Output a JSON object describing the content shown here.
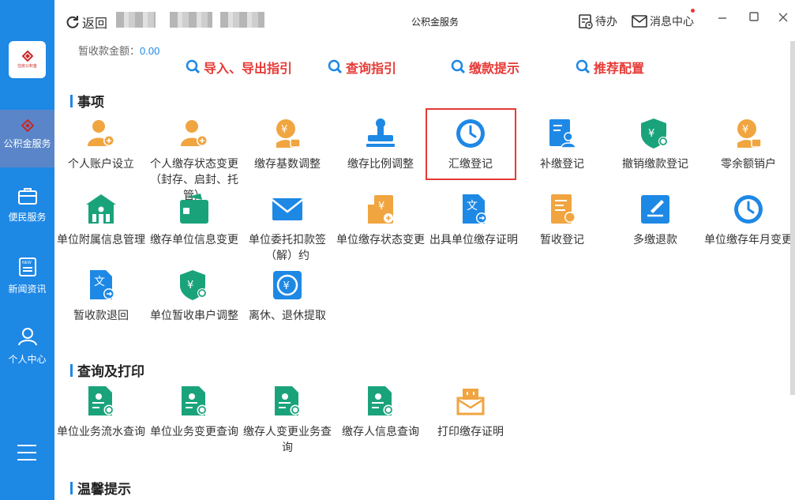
{
  "titlebar": {
    "back_label": "返回",
    "app_title": "公积金服务",
    "todo_label": "待办",
    "messages_label": "消息中心"
  },
  "sidebar": {
    "logo_text": "住房公积金",
    "items": [
      {
        "label": "公积金服务",
        "icon": "coin-icon"
      },
      {
        "label": "便民服务",
        "icon": "briefcase-icon"
      },
      {
        "label": "新闻资讯",
        "icon": "news-icon"
      },
      {
        "label": "个人中心",
        "icon": "user-icon"
      }
    ]
  },
  "main": {
    "amount_label": "暂收款金额：",
    "amount_value": "0.00",
    "guides": [
      "导入、导出指引",
      "查询指引",
      "缴款提示",
      "推荐配置"
    ],
    "sections": {
      "matters": "事项",
      "query": "查询及打印",
      "tips": "温馨提示"
    },
    "matters": [
      {
        "label": "个人账户设立",
        "icon": "user-add-icon"
      },
      {
        "label": "个人缴存状态变更（封存、启封、托管）",
        "icon": "user-add-icon"
      },
      {
        "label": "缴存基数调整",
        "icon": "money-lock-icon"
      },
      {
        "label": "缴存比例调整",
        "icon": "stamp-icon"
      },
      {
        "label": "汇缴登记",
        "icon": "clock-icon"
      },
      {
        "label": "补缴登记",
        "icon": "doc-user-icon"
      },
      {
        "label": "撤销缴款登记",
        "icon": "shield-search-icon"
      },
      {
        "label": "零余额销户",
        "icon": "money-lock-icon"
      },
      {
        "label": "单位附属信息管理",
        "icon": "building-icon"
      },
      {
        "label": "缴存单位信息变更",
        "icon": "wallet-icon"
      },
      {
        "label": "单位委托扣款签（解）约",
        "icon": "mail-icon"
      },
      {
        "label": "单位缴存状态变更",
        "icon": "building-money-icon"
      },
      {
        "label": "出具单位缴存证明",
        "icon": "translate-doc-icon"
      },
      {
        "label": "暂收登记",
        "icon": "bill-icon"
      },
      {
        "label": "多缴退款",
        "icon": "edit-doc-icon"
      },
      {
        "label": "单位缴存年月变更",
        "icon": "clock-icon"
      },
      {
        "label": "暂收款退回",
        "icon": "translate-doc-icon"
      },
      {
        "label": "单位暂收串户调整",
        "icon": "shield-search-icon"
      },
      {
        "label": "离休、退休提取",
        "icon": "yuan-cycle-icon"
      }
    ],
    "queries": [
      {
        "label": "单位业务流水查询",
        "icon": "doc-search-icon"
      },
      {
        "label": "单位业务变更查询",
        "icon": "doc-search-icon"
      },
      {
        "label": "缴存人变更业务查询",
        "icon": "doc-search-icon"
      },
      {
        "label": "缴存人信息查询",
        "icon": "doc-search-icon"
      },
      {
        "label": "打印缴存证明",
        "icon": "printer-icon"
      }
    ]
  },
  "colors": {
    "sidebar": "#1e88e5",
    "active_nav": "#5a86c9",
    "orange": "#f0a540",
    "blue": "#1e88e5",
    "green": "#1aa37b",
    "red": "#e53935"
  }
}
